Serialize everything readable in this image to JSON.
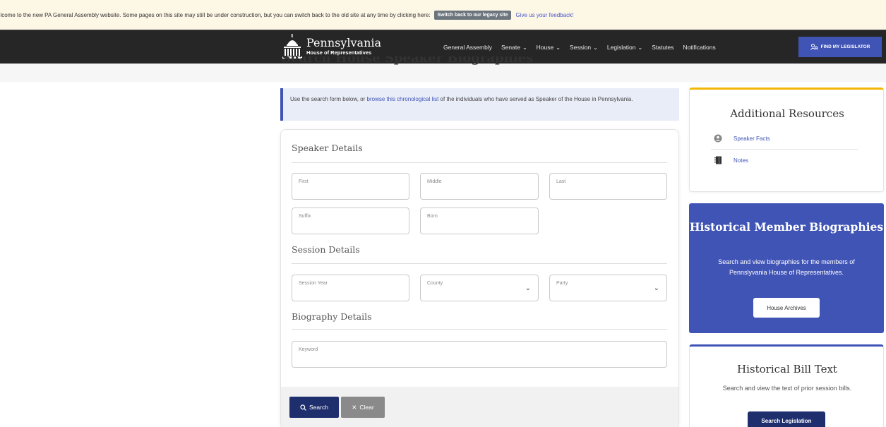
{
  "banner": {
    "text": "elcome to the new PA General Assembly website. Some pages on this site may still be under construction, but you can switch back to the old site at any time by clicking here:",
    "legacy_button": "Switch back to our legacy site",
    "feedback_link": "Give us your feedback!"
  },
  "header": {
    "logo_title": "Pennsylvania",
    "logo_subtitle": "House of Representatives",
    "nav": [
      {
        "label": "General Assembly"
      },
      {
        "label": "Senate"
      },
      {
        "label": "House"
      },
      {
        "label": "Session"
      },
      {
        "label": "Legislation"
      },
      {
        "label": "Statutes"
      },
      {
        "label": "Notifications"
      }
    ],
    "find_button": "FIND MY LEGISLATOR"
  },
  "page": {
    "title": "Search House Speaker Biographies",
    "info_before": "Use the search form below, or ",
    "info_link": "browse this chronological list",
    "info_after": " of the individuals who have served as Speaker of the House in Pennsylvania."
  },
  "form": {
    "speaker_heading": "Speaker Details",
    "session_heading": "Session Details",
    "biography_heading": "Biography Details",
    "fields": {
      "first": "First",
      "middle": "Middle",
      "last": "Last",
      "suffix": "Suffix",
      "born": "Born",
      "session_year": "Session Year",
      "county": "County",
      "party": "Party",
      "keyword": "Keyword"
    },
    "search_button": "Search",
    "clear_button": "Clear"
  },
  "sidebar": {
    "resources_title": "Additional Resources",
    "resources": [
      {
        "label": "Speaker Facts",
        "icon": "person-icon"
      },
      {
        "label": "Notes",
        "icon": "notebook-icon"
      }
    ],
    "historical": {
      "title": "Historical Member Biographies",
      "desc": "Search and view biographies for the members of Pennslyvania House of Representatives.",
      "button": "House Archives"
    },
    "bill": {
      "title": "Historical Bill Text",
      "desc": "Search and view the text of prior session bills.",
      "button": "Search Legislation"
    }
  }
}
